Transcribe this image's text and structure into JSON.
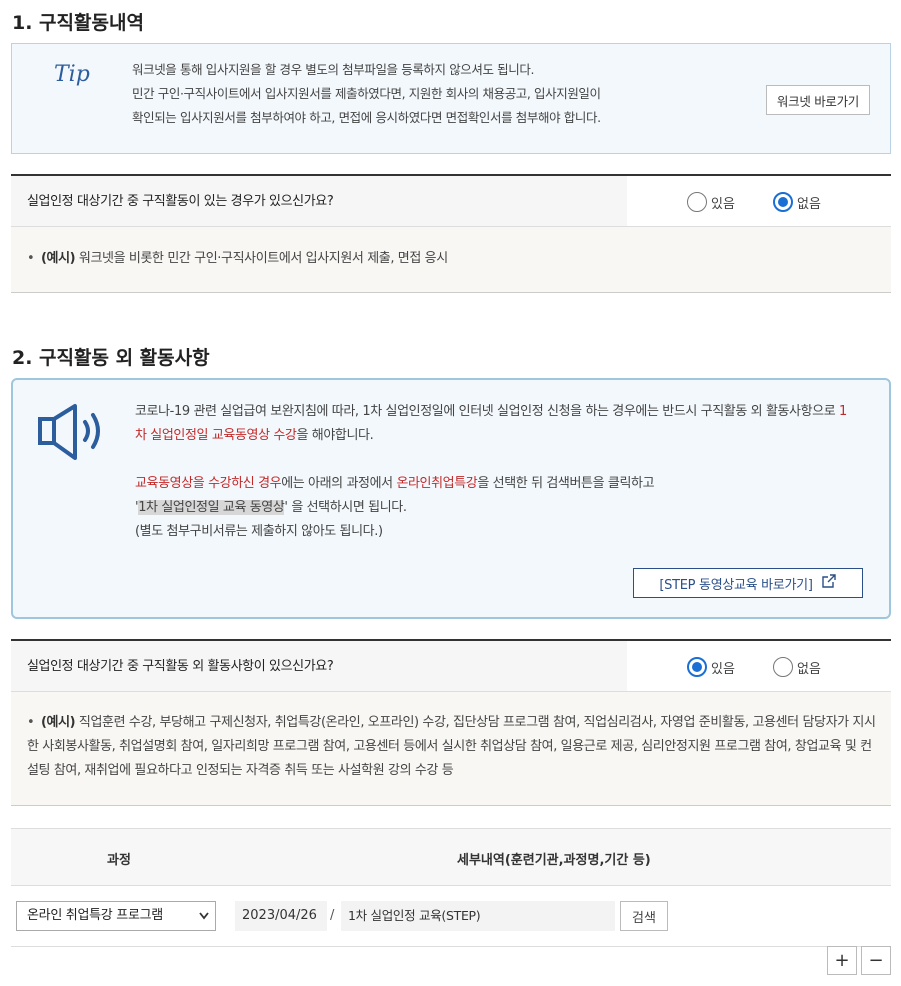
{
  "section1": {
    "title": "1. 구직활동내역",
    "tip": {
      "icon_text": "Tip",
      "lines": [
        "워크넷을 통해 입사지원을 할 경우 별도의 첨부파일을 등록하지 않으셔도 됩니다.",
        "민간 구인·구직사이트에서 입사지원서를 제출하였다면, 지원한 회사의 채용공고, 입사지원일이",
        "확인되는 입사지원서를 첨부하여야 하고, 면접에 응시하였다면 면접확인서를 첨부해야 합니다."
      ],
      "button_label": "워크넷 바로가기"
    },
    "question": "실업인정 대상기간 중 구직활동이 있는 경우가 있으신가요?",
    "option_yes": "있음",
    "option_no": "없음",
    "selected": "없음",
    "example_label": "(예시)",
    "example_text": " 워크넷을 비롯한 민간 구인·구직사이트에서 입사지원서 제출, 면접 응시"
  },
  "section2": {
    "title": "2. 구직활동 외 활동사항",
    "notice": {
      "icon": "speaker-icon",
      "p1_a": "코로나-19 관련 실업급여 보완지침에 따라, 1차 실업인정일에 인터넷 실업인정 신청을 하는 경우에는 반드시 구직활동 외 활동사항으로 ",
      "p1_red": "1차 실업인정일 교육동영상 수강",
      "p1_b": "을 해야합니다.",
      "p2_red1": "교육동영상을 수강하신 경우",
      "p2_a": "에는 아래의 과정에서 ",
      "p2_red2": "온라인취업특강",
      "p2_b": "을 선택한 뒤 검색버튼을 클릭하고",
      "p3_quote_open": "'",
      "p3_hl": "1차 실업인정일 교육 동영상",
      "p3_rest": "' 을 선택하시면 됩니다.",
      "p4": "(별도 첨부구비서류는 제출하지 않아도 됩니다.)",
      "button_label": "[STEP 동영상교육 바로가기]"
    },
    "question": "실업인정 대상기간 중 구직활동 외 활동사항이 있으신가요?",
    "option_yes": "있음",
    "option_no": "없음",
    "selected": "있음",
    "example_label": "(예시)",
    "example_text": " 직업훈련 수강, 부당해고 구제신청자, 취업특강(온라인, 오프라인) 수강, 집단상담 프로그램 참여, 직업심리검사, 자영업 준비활동, 고용센터 담당자가 지시한 사회봉사활동, 취업설명회 참여, 일자리희망 프로그램 참여, 고용센터 등에서 실시한 취업상담 참여, 일용근로 제공, 심리안정지원 프로그램 참여, 창업교육 및 컨설팅 참여, 재취업에 필요하다고 인정되는 자격증 취득 또는 사설학원 강의 수강 등"
  },
  "course_table": {
    "col_course": "과정",
    "col_detail": "세부내역(훈련기관,과정명,기간 등)",
    "row": {
      "course_select": "온라인 취업특강 프로그램",
      "date": "2023/04/26",
      "separator": "/",
      "detail": "1차 실업인정 교육(STEP)",
      "search_label": "검색"
    },
    "add_label": "+",
    "remove_label": "−"
  }
}
